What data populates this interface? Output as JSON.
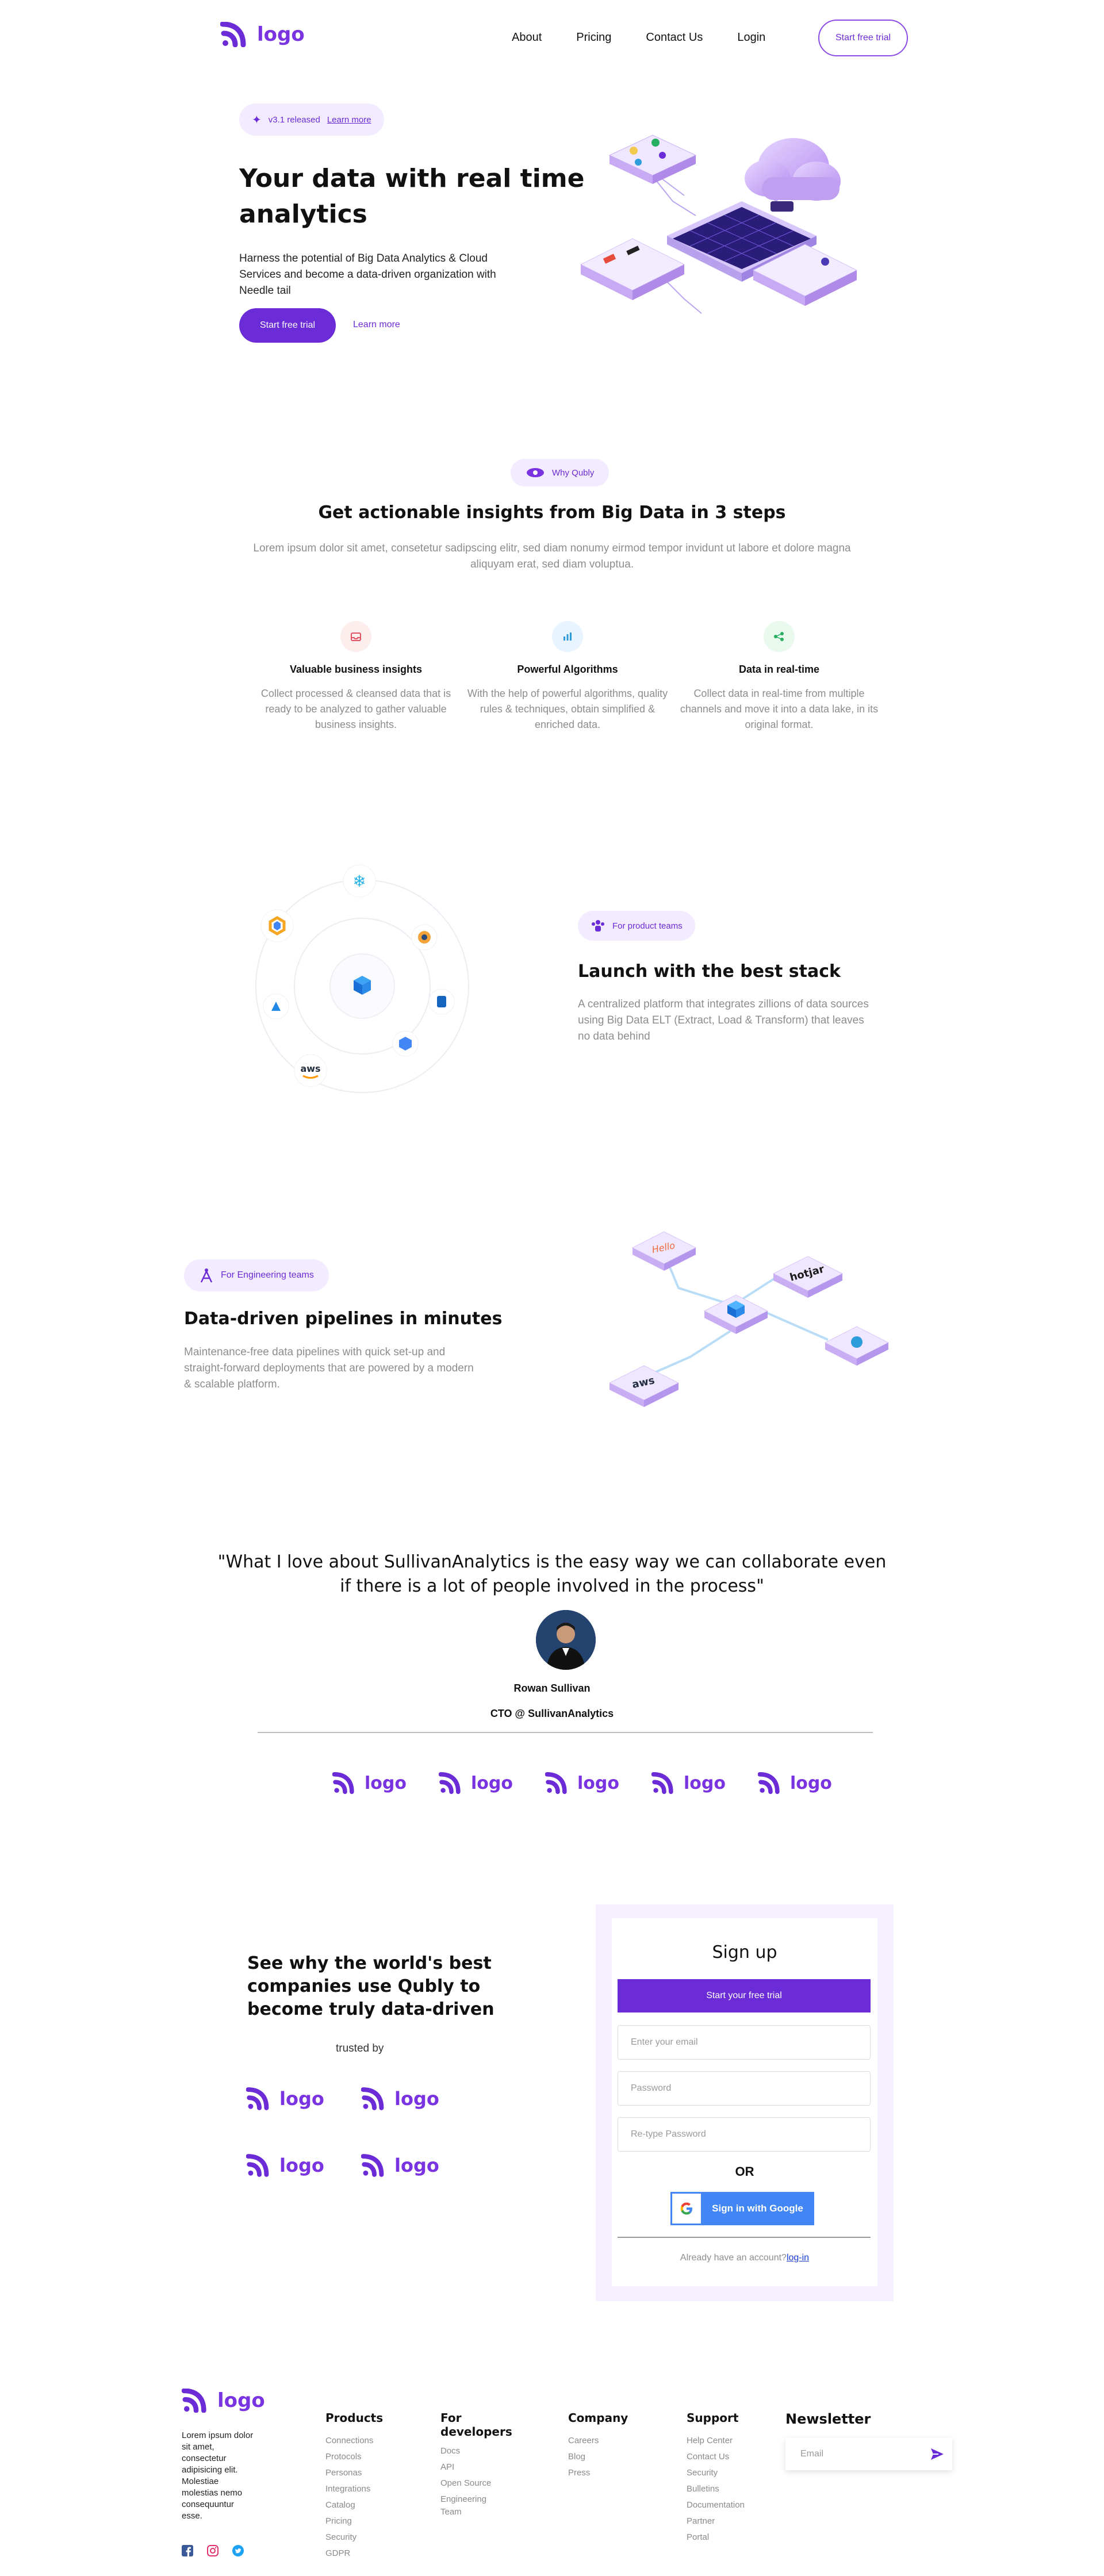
{
  "brand": {
    "logo_text": "logo",
    "accent": "#6b2bd6"
  },
  "nav": {
    "items": [
      "About",
      "Pricing",
      "Contact Us",
      "Login"
    ],
    "cta": "Start free trial"
  },
  "hero": {
    "badge_text": "v3.1 released",
    "badge_link": "Learn more",
    "title_line1": "Your data with real time",
    "title_line2": "analytics",
    "description": "Harness the potential of Big Data Analytics & Cloud Services and become a data-driven organization with Needle tail",
    "primary_cta": "Start free trial",
    "secondary_cta": "Learn more"
  },
  "why": {
    "badge": "Why Qubly",
    "title": "Get actionable insights from Big Data in 3 steps",
    "subtitle": "Lorem ipsum dolor sit amet, consetetur sadipscing elitr, sed diam nonumy eirmod tempor invidunt ut labore et dolore magna aliquyam erat, sed diam voluptua.",
    "features": [
      {
        "title": "Valuable business insights",
        "text": "Collect processed & cleansed data that is ready to be analyzed to gather valuable business insights.",
        "icon": "inbox-icon"
      },
      {
        "title": "Powerful Algorithms",
        "text": "With the help of powerful algorithms, quality rules & techniques, obtain simplified & enriched data.",
        "icon": "bar-chart-icon"
      },
      {
        "title": "Data in real-time",
        "text": "Collect data in real-time from multiple channels and move it into a data lake, in its original format.",
        "icon": "nodes-icon"
      }
    ]
  },
  "stack": {
    "badge": "For product teams",
    "title": "Launch with the best stack",
    "text": "A centralized platform that integrates zillions of data sources using Big Data ELT (Extract, Load & Transform) that leaves no data behind",
    "aws_label": "aws"
  },
  "pipelines": {
    "badge": "For Engineering teams",
    "title": "Data-driven pipelines in minutes",
    "text": "Maintenance-free data pipelines with quick set-up and straight-forward deployments that are powered by a modern & scalable platform.",
    "tiles": [
      "Hello",
      "hotjar",
      "aws"
    ]
  },
  "testimonial": {
    "quote_line1": "\"What I love about SullivanAnalytics is the easy way we can collaborate even",
    "quote_line2": "if there is a lot of people involved in the process\"",
    "name": "Rowan Sullivan",
    "role": "CTO @ SullivanAnalytics"
  },
  "trusted": {
    "title_line1": "See why the world's best",
    "title_line2": "companies use Qubly to",
    "title_line3": "become truly data-driven",
    "subtitle": "trusted by"
  },
  "signup": {
    "title": "Sign up",
    "cta": "Start your free trial",
    "email_placeholder": "Enter your email",
    "password_placeholder": "Password",
    "retype_placeholder": "Re-type Password",
    "or": "OR",
    "google": "Sign in with Google",
    "have_account": "Already have an account?",
    "login": "log-in"
  },
  "footer": {
    "about": "Lorem ipsum dolor sit amet, consectetur adipisicing elit. Molestiae molestias nemo consequuntur esse.",
    "columns": [
      {
        "title": "Products",
        "items": [
          "Connections",
          "Protocols",
          "Personas",
          "Integrations",
          "Catalog",
          "Pricing",
          "Security",
          "GDPR"
        ]
      },
      {
        "title_line1": "For",
        "title_line2": "developers",
        "items": [
          "Docs",
          "API",
          "Open Source",
          "Engineering",
          "Team"
        ]
      },
      {
        "title": "Company",
        "items": [
          "Careers",
          "Blog",
          "Press"
        ]
      },
      {
        "title": "Support",
        "items": [
          "Help Center",
          "Contact Us",
          "Security",
          "Bulletins",
          "Documentation",
          "Partner",
          "Portal"
        ]
      }
    ],
    "newsletter_title": "Newsletter",
    "newsletter_placeholder": "Email"
  }
}
